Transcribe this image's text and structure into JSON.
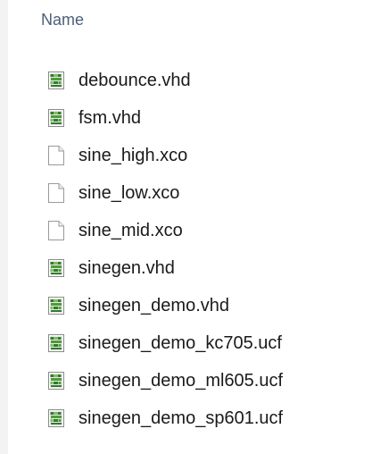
{
  "header": {
    "name_label": "Name"
  },
  "files": [
    {
      "name": "debounce.vhd",
      "icon": "vhd-file-icon"
    },
    {
      "name": "fsm.vhd",
      "icon": "vhd-file-icon"
    },
    {
      "name": "sine_high.xco",
      "icon": "blank-file-icon"
    },
    {
      "name": "sine_low.xco",
      "icon": "blank-file-icon"
    },
    {
      "name": "sine_mid.xco",
      "icon": "blank-file-icon"
    },
    {
      "name": "sinegen.vhd",
      "icon": "vhd-file-icon"
    },
    {
      "name": "sinegen_demo.vhd",
      "icon": "vhd-file-icon"
    },
    {
      "name": "sinegen_demo_kc705.ucf",
      "icon": "vhd-file-icon"
    },
    {
      "name": "sinegen_demo_ml605.ucf",
      "icon": "vhd-file-icon"
    },
    {
      "name": "sinegen_demo_sp601.ucf",
      "icon": "vhd-file-icon"
    }
  ],
  "colors": {
    "header_text": "#4c607a",
    "file_text": "#1a1a1a",
    "icon_green": "#3f8a2c"
  }
}
